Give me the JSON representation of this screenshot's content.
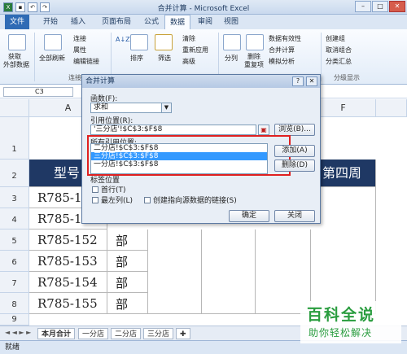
{
  "window": {
    "title": "合并计算 - Microsoft Excel"
  },
  "tabs": [
    "文件",
    "开始",
    "插入",
    "页面布局",
    "公式",
    "数据",
    "审阅",
    "视图"
  ],
  "ribbon": {
    "get_external": [
      "获取",
      "外部数据"
    ],
    "refresh_all": "全部刷新",
    "connections": [
      "连接",
      "属性",
      "编辑链接"
    ],
    "conn_group": "连接",
    "sort_asc": "A↓Z",
    "sort": "排序",
    "filter": "筛选",
    "clear": "清除",
    "reapply": "重新应用",
    "advanced": "高级",
    "text_to_cols": "分列",
    "remove_dup": [
      "删除",
      "重复项"
    ],
    "validation": "数据有效性",
    "consolidate": "合并计算",
    "whatif": "模拟分析",
    "group": "创建组",
    "ungroup": "取消组合",
    "subtotal": "分类汇总",
    "outline_group": "分级显示"
  },
  "formula": {
    "namebox": "C3"
  },
  "columns": [
    "A",
    "F"
  ],
  "rows": [
    "1",
    "2",
    "3",
    "4",
    "5",
    "6",
    "7",
    "8",
    "9"
  ],
  "cells": {
    "r2": [
      "型号",
      "第四周"
    ],
    "r3": [
      "R785-1"
    ],
    "r4": [
      "R785-1"
    ],
    "r5": [
      "R785-152",
      "部"
    ],
    "r6": [
      "R785-153",
      "部"
    ],
    "r7": [
      "R785-154",
      "部"
    ],
    "r8": [
      "R785-155",
      "部"
    ]
  },
  "dialog": {
    "title": "合并计算",
    "help": "?",
    "function_label": "函数(F):",
    "function_value": "求和",
    "ref_label": "引用位置(R):",
    "ref_value": "'三分店'!$C$3:$F$8",
    "browse": "浏览(B)...",
    "all_refs_label": "所有引用位置:",
    "refs": [
      "二分店!$C$3:$F$8",
      "三分店!$C$3:$F$8",
      "一分店!$C$3:$F$8"
    ],
    "add": "添加(A)",
    "delete": "删除(D)",
    "labels_title": "标签位置",
    "first_row": "首行(T)",
    "left_col": "最左列(L)",
    "link_source": "创建指向源数据的链接(S)",
    "ok": "确定",
    "close": "关闭"
  },
  "sheets": [
    "本月合计",
    "一分店",
    "二分店",
    "三分店"
  ],
  "status": "就绪",
  "watermark": {
    "main": "百科全说",
    "sub": "助你轻松解决"
  }
}
